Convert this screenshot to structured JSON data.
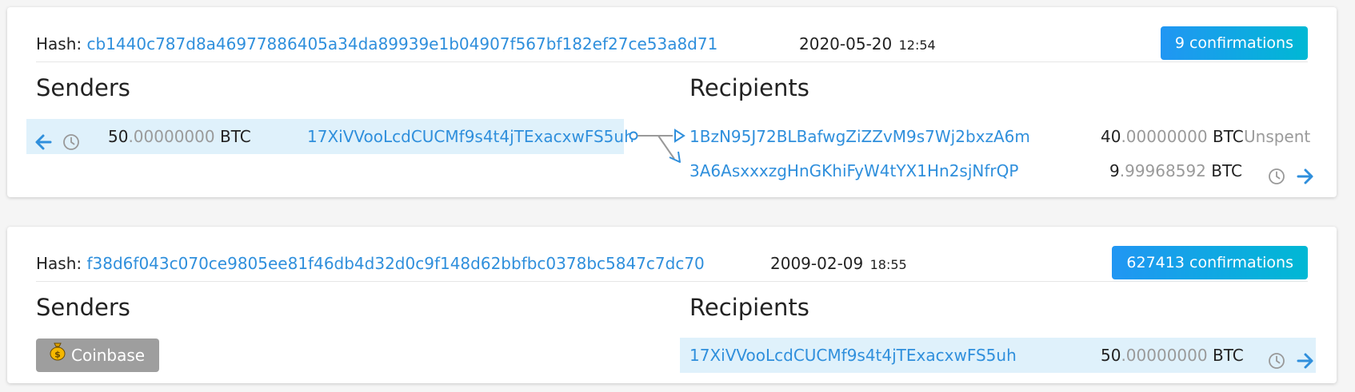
{
  "transactions": [
    {
      "hash_label": "Hash:",
      "hash": "cb1440c787d8a46977886405a34da89939e1b04907f567bf182ef27ce53a8d71",
      "date": "2020-05-20",
      "time": "12:54",
      "confirmations": "9 confirmations",
      "senders_title": "Senders",
      "recipients_title": "Recipients",
      "senders": [
        {
          "amount_int": "50",
          "amount_frac": ".00000000",
          "unit": "BTC",
          "address": "17XiVVooLcdCUCMf9s4t4jTExacxwFS5uh"
        }
      ],
      "recipients": [
        {
          "address": "1BzN95J72BLBafwgZiZZvM9s7Wj2bxzA6m",
          "amount_int": "40",
          "amount_frac": ".00000000",
          "unit": "BTC",
          "status": "Unspent"
        },
        {
          "address": "3A6AsxxxzgHnGKhiFyW4tYX1Hn2sjNfrQP",
          "amount_int": "9",
          "amount_frac": ".99968592",
          "unit": "BTC"
        }
      ]
    },
    {
      "hash_label": "Hash:",
      "hash": "f38d6f043c070ce9805ee81f46db4d32d0c9f148d62bbfbc0378bc5847c7dc70",
      "date": "2009-02-09",
      "time": "18:55",
      "confirmations": "627413 confirmations",
      "senders_title": "Senders",
      "recipients_title": "Recipients",
      "coinbase_label": "Coinbase",
      "recipients": [
        {
          "address": "17XiVVooLcdCUCMf9s4t4jTExacxwFS5uh",
          "amount_int": "50",
          "amount_frac": ".00000000",
          "unit": "BTC"
        }
      ]
    }
  ],
  "colors": {
    "link": "#2f8fdc",
    "highlight": "#dff1fb",
    "badge_start": "#2196f3",
    "badge_end": "#00b8d4",
    "coinbase_bg": "#9e9e9e"
  },
  "icons": {
    "back": "arrow-left-icon",
    "history": "clock-icon",
    "forward": "arrow-right-icon",
    "flow": "flow-arrows-icon",
    "coinbase": "money-bag-icon"
  }
}
